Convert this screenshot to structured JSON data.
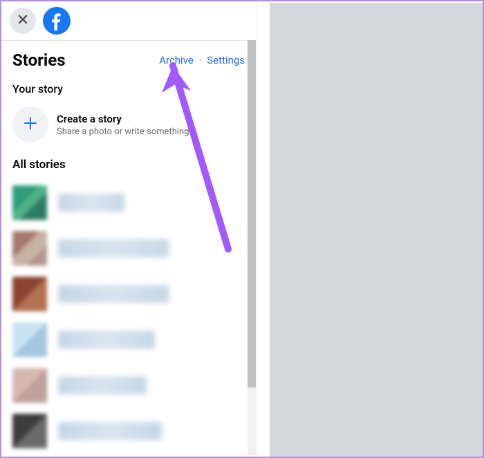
{
  "topbar": {
    "close_label": "Close",
    "logo_alt": "Facebook"
  },
  "header": {
    "title": "Stories",
    "archive": "Archive",
    "settings": "Settings"
  },
  "your_story": {
    "title": "Your story",
    "create_title": "Create a story",
    "create_sub": "Share a photo or write something."
  },
  "all_stories": {
    "title": "All stories",
    "items": [
      {
        "avatar_style": "background:linear-gradient(135deg,#2e9c7a 0 40%,#4fb189 40% 60%,#2b7e64 60% 100%);",
        "name_width": 96
      },
      {
        "avatar_style": "background:linear-gradient(135deg,#a57a6e 0 40%,#c7b3a3 40% 70%,#b0978d 70% 100%);",
        "name_width": 160
      },
      {
        "avatar_style": "background:linear-gradient(135deg,#8a4431 0 50%,#b47150 50% 100%);",
        "name_width": 160
      },
      {
        "avatar_style": "background:linear-gradient(135deg,#c7e3f4 0 50%,#a4c7de 50% 100%);",
        "name_width": 140
      },
      {
        "avatar_style": "background:linear-gradient(135deg,#d7b8b0 0 50%,#bfa09a 50% 100%);",
        "name_width": 128
      },
      {
        "avatar_style": "background:linear-gradient(135deg,#3d3d3d 0 50%,#6a6a6a 50% 100%);",
        "name_width": 150
      }
    ]
  },
  "colors": {
    "fb_blue": "#1877f2",
    "link_blue": "#216fdb",
    "arrow": "#a259ff"
  }
}
